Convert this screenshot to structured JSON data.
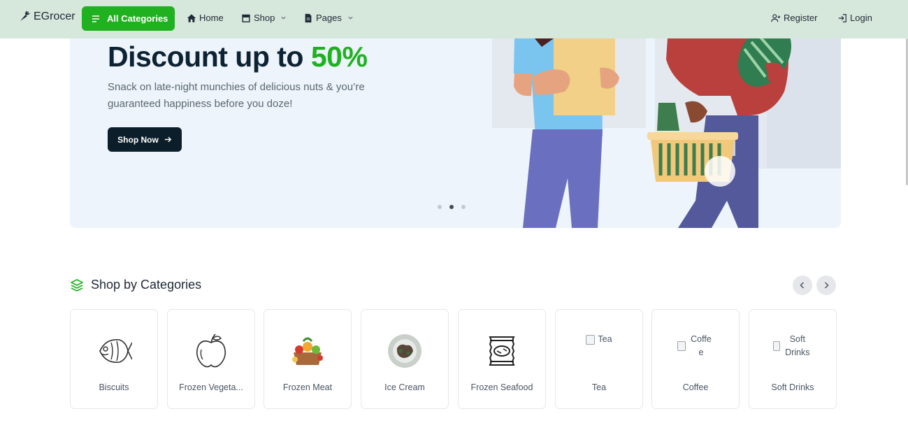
{
  "navbar": {
    "brand": "EGrocer",
    "all_categories": "All Categories",
    "links": {
      "home": "Home",
      "shop": "Shop",
      "pages": "Pages"
    },
    "register": "Register",
    "login": "Login",
    "accent": "#1fb11f"
  },
  "hero": {
    "title_prefix": "Discount up to",
    "title_highlight": "50%",
    "subtitle": "Snack on late-night munchies of delicious nuts & you’re guaranteed happiness before you doze!",
    "cta": "Shop Now",
    "active_slide": 2,
    "slide_count": 3
  },
  "categories_section": {
    "title": "Shop by Categories",
    "items": [
      {
        "name": "Biscuits",
        "icon": "fish-icon"
      },
      {
        "name": "Frozen Vegeta...",
        "icon": "apple-icon"
      },
      {
        "name": "Frozen Meat",
        "icon": "produce-basket-icon"
      },
      {
        "name": "Ice Cream",
        "icon": "plated-dish-icon"
      },
      {
        "name": "Frozen Seafood",
        "icon": "chips-bag-icon"
      },
      {
        "name": "Tea",
        "icon": "broken-image-icon",
        "alt": "Tea"
      },
      {
        "name": "Coffee",
        "icon": "broken-image-icon",
        "alt": "Coffe e"
      },
      {
        "name": "Soft Drinks",
        "icon": "broken-image-icon",
        "alt": "Soft Drinks"
      }
    ]
  }
}
